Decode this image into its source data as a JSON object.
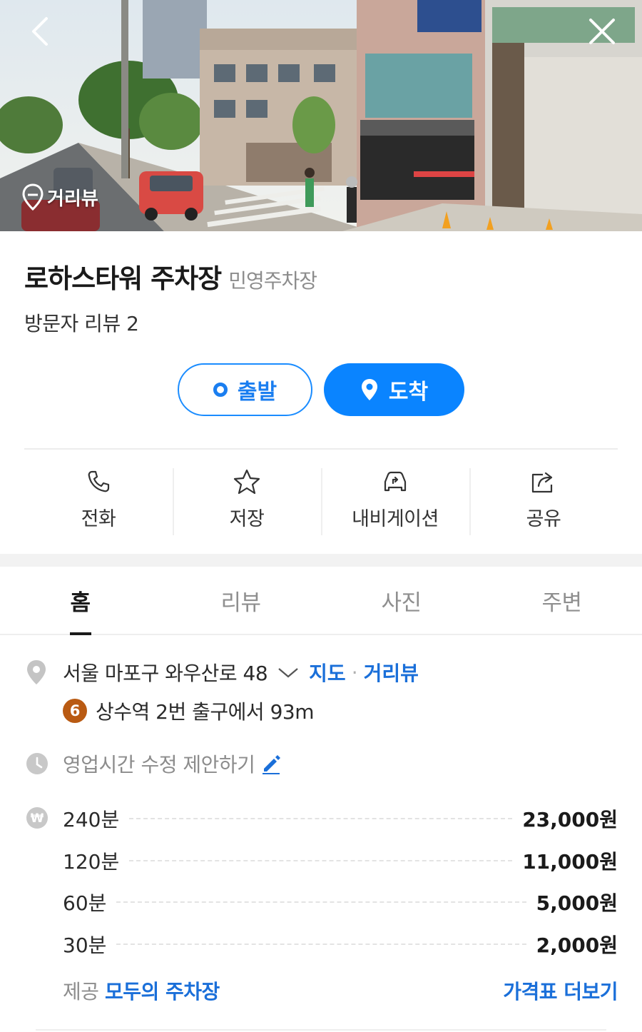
{
  "hero": {
    "back_icon": "chevron-left-icon",
    "close_icon": "close-icon",
    "streetview_label": "거리뷰"
  },
  "place": {
    "name": "로하스타워 주차장",
    "category": "민영주차장",
    "reviews": "방문자 리뷰 2"
  },
  "route": {
    "start_label": "출발",
    "arrive_label": "도착",
    "accent": "#0a84ff"
  },
  "actions": [
    {
      "label": "전화",
      "icon": "phone-icon"
    },
    {
      "label": "저장",
      "icon": "star-icon"
    },
    {
      "label": "내비게이션",
      "icon": "car-navigation-icon"
    },
    {
      "label": "공유",
      "icon": "share-icon"
    }
  ],
  "tabs": [
    {
      "label": "홈",
      "active": true
    },
    {
      "label": "리뷰",
      "active": false
    },
    {
      "label": "사진",
      "active": false
    },
    {
      "label": "주변",
      "active": false
    }
  ],
  "info": {
    "address": "서울 마포구 와우산로 48",
    "map_link": "지도",
    "streetview_link": "거리뷰",
    "subway_line": "6",
    "subway_line_color": "#b95a12",
    "subway_text": "상수역 2번 출구에서 93m",
    "hours_suggest": "영업시간 수정 제안하기"
  },
  "prices": [
    {
      "duration": "240분",
      "amount": "23,000원"
    },
    {
      "duration": "120분",
      "amount": "11,000원"
    },
    {
      "duration": "60분",
      "amount": "5,000원"
    },
    {
      "duration": "30분",
      "amount": "2,000원"
    }
  ],
  "footer": {
    "provider_prefix": "제공",
    "provider_name": "모두의 주차장",
    "more_prices": "가격표 더보기"
  }
}
